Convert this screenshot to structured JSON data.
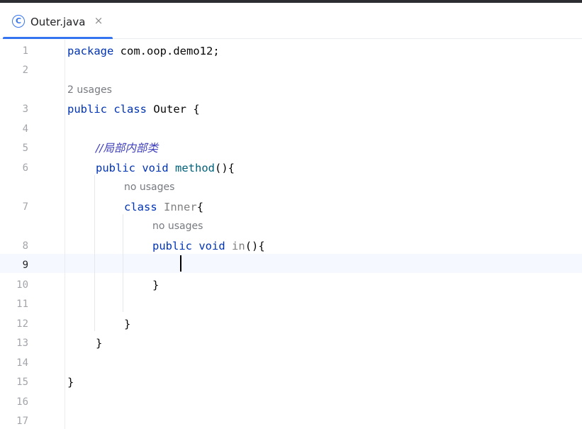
{
  "tab": {
    "icon": "class-icon",
    "icon_glyph": "C",
    "label": "Outer.java",
    "close_glyph": "×"
  },
  "editor": {
    "current_line": "9",
    "line_numbers": [
      "1",
      "2",
      "3",
      "4",
      "5",
      "6",
      "7",
      "8",
      "9",
      "10",
      "11",
      "12",
      "13",
      "14",
      "15",
      "16",
      "17"
    ],
    "hints": {
      "outer_usages": "2 usages",
      "inner_usages": "no usages",
      "in_usages": "no usages"
    },
    "code": {
      "package_kw": "package",
      "package_name": "com.oop.demo12;",
      "public_kw": "public",
      "class_kw": "class",
      "outer_name": "Outer",
      "open_brace": "{",
      "comment": "//局部内部类",
      "void_kw": "void",
      "method_name": "method",
      "method_parens": "(){",
      "inner_name": "Inner",
      "in_name": "in",
      "close_brace": "}"
    }
  }
}
